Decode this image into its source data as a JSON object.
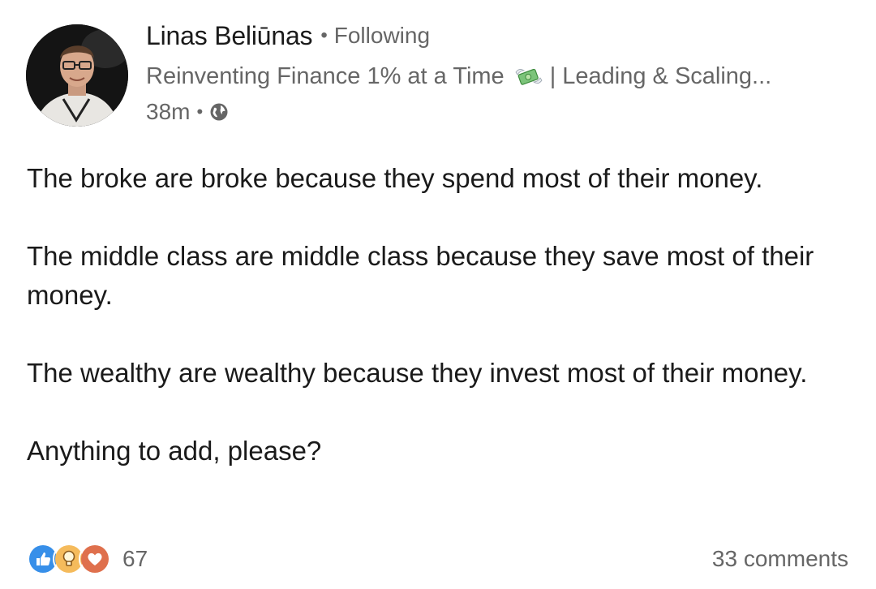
{
  "author": {
    "name": "Linas Beliūnas",
    "follow_status": "Following",
    "headline_part1": "Reinventing Finance 1% at a Time",
    "headline_icon": "money-with-wings-icon",
    "headline_part2": "| Leading & Scaling...",
    "timestamp": "38m",
    "visibility_icon": "globe-icon"
  },
  "post": {
    "paragraphs": [
      "The broke are broke because they spend most of their money.",
      "The middle class are middle class because they save most of their money.",
      "The wealthy are wealthy because they invest most of their money.",
      "Anything to add, please?"
    ]
  },
  "social": {
    "reaction_icons": [
      "like-icon",
      "insightful-icon",
      "love-icon"
    ],
    "reaction_count": "67",
    "comments": "33 comments"
  },
  "colors": {
    "like": "#378fe9",
    "insightful": "#f5bb5c",
    "love": "#df704d",
    "secondary_text": "#666666"
  }
}
